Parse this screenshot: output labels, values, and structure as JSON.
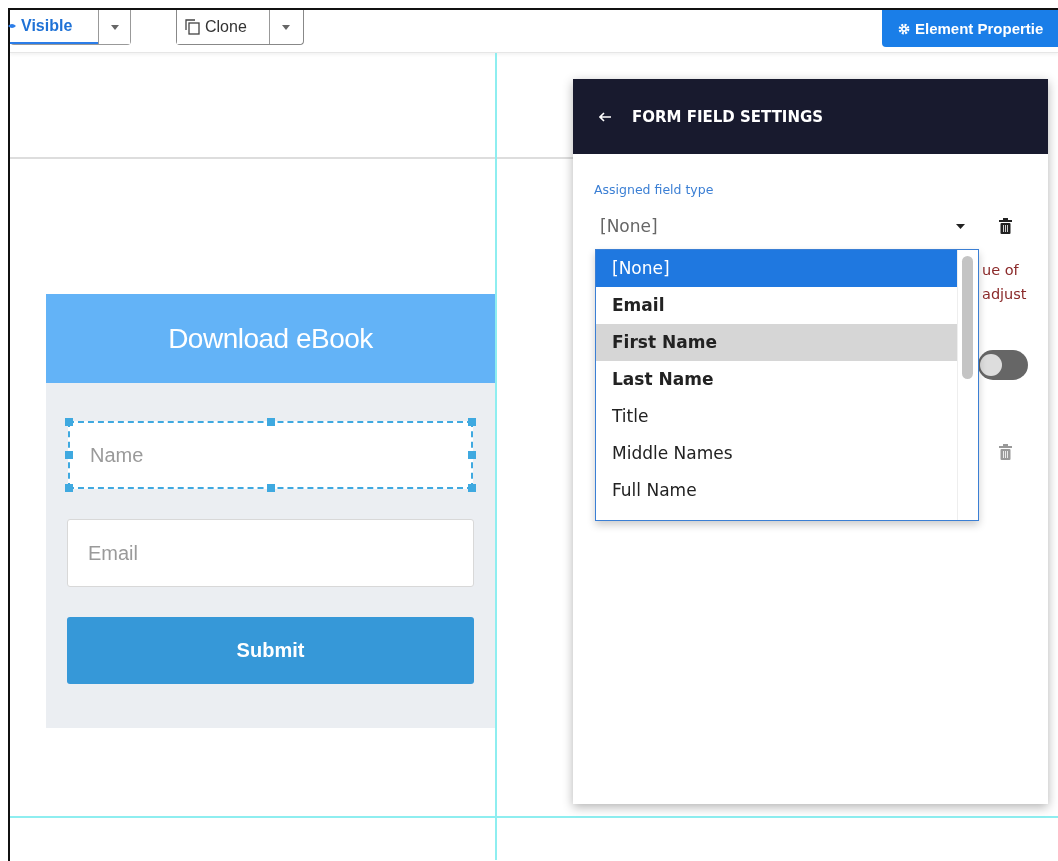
{
  "toolbar": {
    "visibility_button": "Visible",
    "clone_button": "Clone",
    "properties_button": "Element Propertie"
  },
  "form": {
    "title": "Download eBook",
    "fields": [
      {
        "placeholder": "Name",
        "selected": true
      },
      {
        "placeholder": "Email",
        "selected": false
      }
    ],
    "submit": "Submit"
  },
  "panel": {
    "title": "FORM FIELD SETTINGS",
    "field_label": "Assigned field type",
    "select_value": "[None]",
    "hidden_text": [
      "ue of",
      "adjust"
    ],
    "toggle": {
      "on": false
    },
    "dropdown": [
      {
        "label": "[None]",
        "selected": true,
        "hovered": false,
        "emphasized": false
      },
      {
        "label": "Email",
        "selected": false,
        "hovered": false,
        "emphasized": true
      },
      {
        "label": "First Name",
        "selected": false,
        "hovered": true,
        "emphasized": true
      },
      {
        "label": "Last Name",
        "selected": false,
        "hovered": false,
        "emphasized": true
      },
      {
        "label": "Title",
        "selected": false,
        "hovered": false,
        "emphasized": false
      },
      {
        "label": "Middle Names",
        "selected": false,
        "hovered": false,
        "emphasized": false
      },
      {
        "label": "Full Name",
        "selected": false,
        "hovered": false,
        "emphasized": false
      }
    ]
  }
}
